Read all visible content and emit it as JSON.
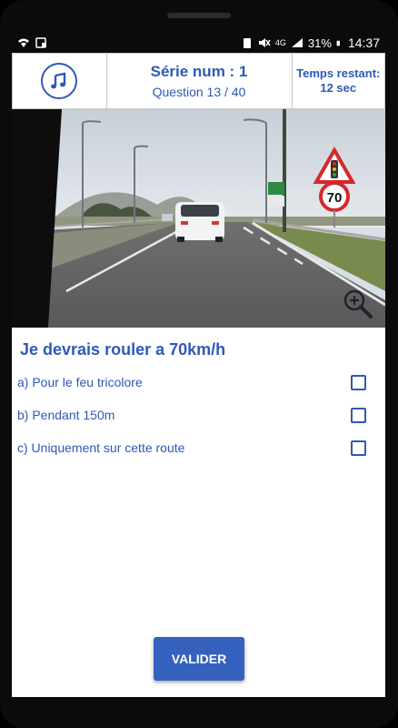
{
  "status_bar": {
    "battery": "31%",
    "time": "14:37",
    "network": "4G"
  },
  "header": {
    "music_icon": "music-note-icon",
    "series_title": "Série num : 1",
    "question_progress": "Question 13 / 40",
    "timer_label": "Temps restant:",
    "timer_value": "12 sec"
  },
  "photo": {
    "zoom_icon": "zoom-in-icon",
    "sign_speed": "70"
  },
  "question": {
    "text": "Je devrais rouler a 70km/h",
    "answers": [
      {
        "label": "a) Pour le feu tricolore",
        "checked": false
      },
      {
        "label": "b) Pendant 150m",
        "checked": false
      },
      {
        "label": "c) Uniquement sur cette route",
        "checked": false
      }
    ]
  },
  "actions": {
    "validate_label": "VALIDER"
  },
  "colors": {
    "accent": "#2e59b8",
    "button": "#3561bf"
  }
}
